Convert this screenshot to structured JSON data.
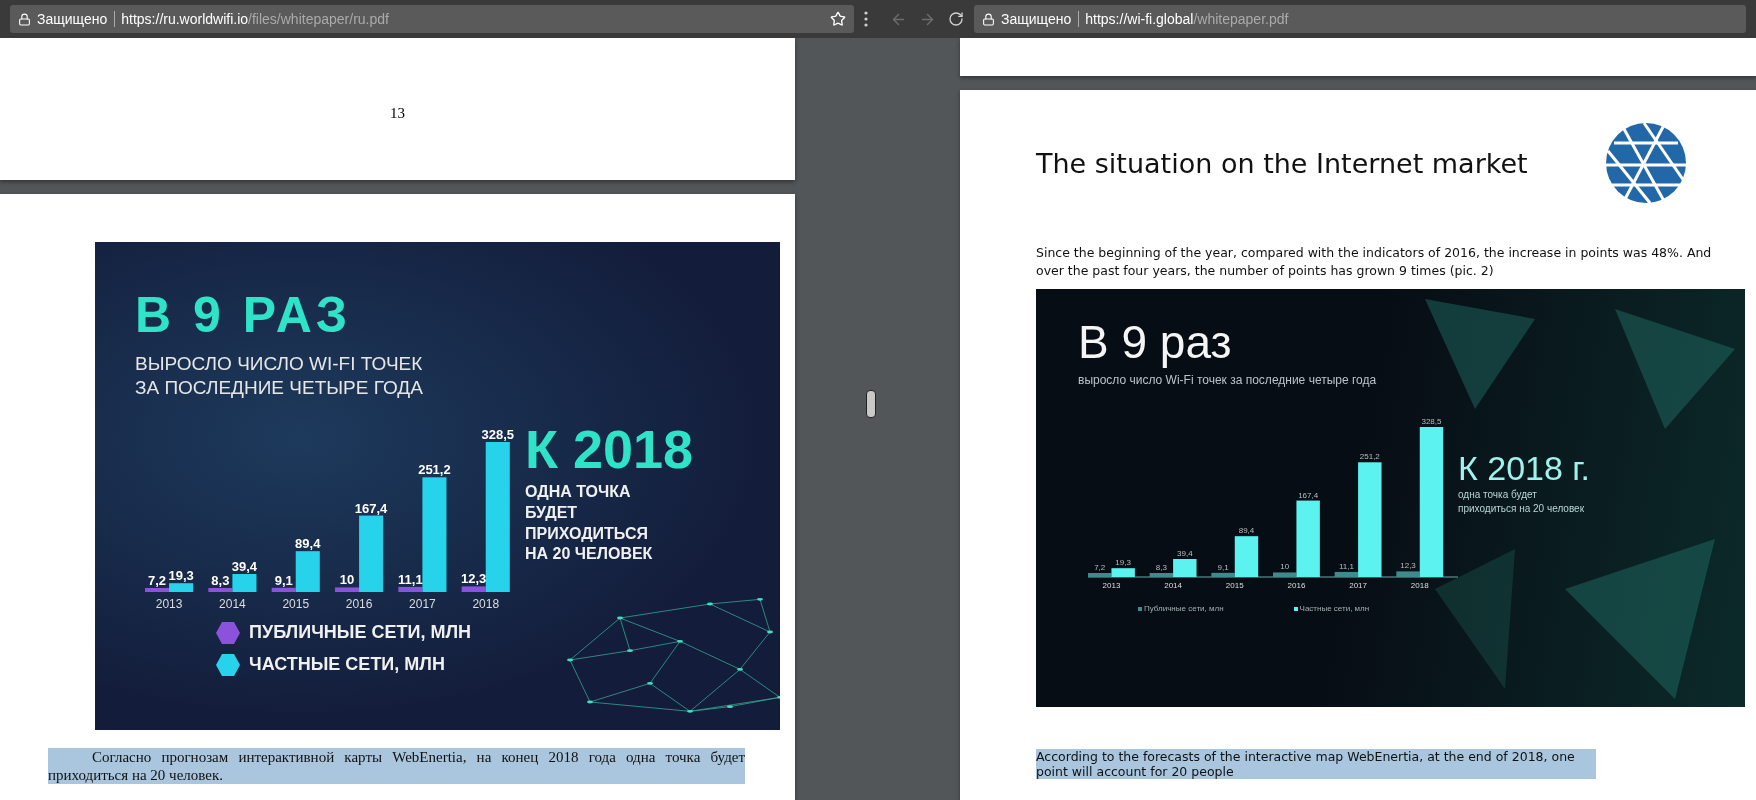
{
  "left_window": {
    "address_bar": {
      "security_label": "Защищено",
      "url_host": "https://ru.worldwifi.io",
      "url_path": "/files/whitepaper/ru.pdf"
    },
    "pdf": {
      "page_number": "13",
      "infographic": {
        "headline": "В 9 РАЗ",
        "subtitle_lines": [
          "ВЫРОСЛО ЧИСЛО WI-FI ТОЧЕК",
          "ЗА ПОСЛЕДНИЕ ЧЕТЫРЕ ГОДА"
        ],
        "callout_title": "К 2018",
        "callout_lines": [
          "ОДНА ТОЧКА",
          "БУДЕТ",
          "ПРИХОДИТЬСЯ",
          "НА 20 ЧЕЛОВЕК"
        ],
        "chart_data": {
          "type": "bar",
          "categories": [
            "2013",
            "2014",
            "2015",
            "2016",
            "2017",
            "2018"
          ],
          "series": [
            {
              "name": "ПУБЛИЧНЫЕ СЕТИ, МЛН",
              "color": "#8b52dc",
              "values": [
                7.2,
                8.3,
                9.1,
                10,
                11.1,
                12.3
              ],
              "value_labels": [
                "7,2",
                "8,3",
                "9,1",
                "10",
                "11,1",
                "12,3"
              ]
            },
            {
              "name": "ЧАСТНЫЕ СЕТИ, МЛН",
              "color": "#26d3ea",
              "values": [
                19.3,
                39.4,
                89.4,
                167.4,
                251.2,
                328.5
              ],
              "value_labels": [
                "19,3",
                "39,4",
                "89,4",
                "167,4",
                "251,2",
                "328,5"
              ]
            }
          ]
        }
      },
      "caption": {
        "text": "Согласно прогнозам интерактивной карты WebEnertia, на конец 2018 года одна точка будет приходиться на 20 человек.",
        "highlighted": true
      }
    }
  },
  "right_window": {
    "address_bar": {
      "security_label": "Защищено",
      "url_host": "https://wi-fi.global",
      "url_path": "/whitepaper.pdf"
    },
    "pdf": {
      "heading": "The situation on the Internet market",
      "paragraph": "Since the beginning of the year, compared with the indicators of 2016, the increase in points was 48%. And over the past four years, the number of points has grown 9 times (pic. 2)",
      "infographic": {
        "headline": "В 9 раз",
        "subtitle": "выросло число Wi-Fi точек за последние четыре года",
        "callout_title": "К 2018 г.",
        "callout_lines": [
          "одна точка будет",
          "приходиться на 20 человек"
        ],
        "chart_data": {
          "type": "bar",
          "categories": [
            "2013",
            "2014",
            "2015",
            "2016",
            "2017",
            "2018"
          ],
          "series": [
            {
              "name": "Публичные сети, млн",
              "color": "#3f8a8c",
              "values": [
                7.2,
                8.3,
                9.1,
                10,
                11.1,
                12.3
              ],
              "value_labels": [
                "7,2",
                "8,3",
                "9,1",
                "10",
                "11,1",
                "12,3"
              ]
            },
            {
              "name": "Частные сети, млн",
              "color": "#5cf2f0",
              "values": [
                19.3,
                39.4,
                89.4,
                167.4,
                251.2,
                328.5
              ],
              "value_labels": [
                "19,3",
                "39,4",
                "89,4",
                "167,4",
                "251,2",
                "328,5"
              ]
            }
          ]
        }
      },
      "caption": {
        "text": "According to the forecasts of the interactive map WebEnertia, at the end of 2018, one point will account for 20 people",
        "highlighted": true
      }
    }
  }
}
